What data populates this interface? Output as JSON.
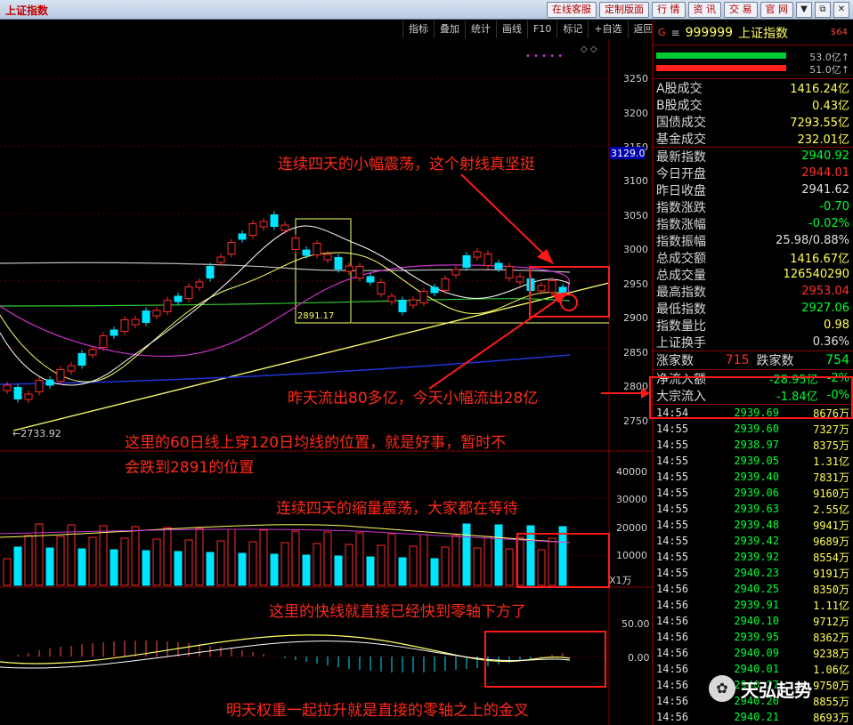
{
  "titlebar": {
    "title": "上证指数",
    "menu": [
      "在线客服",
      "定制版面",
      "行 情",
      "资 讯",
      "交 易",
      "官 网"
    ],
    "window_buttons": [
      "▼",
      "⧉",
      "✕"
    ]
  },
  "toolbar": [
    "指标",
    "叠加",
    "统计",
    "画线",
    "F10",
    "标记",
    "+自选",
    "返回"
  ],
  "chart": {
    "price_axis": [
      "3250",
      "3200",
      "3150",
      "3100",
      "3050",
      "3000",
      "2950",
      "2900",
      "2850",
      "2800",
      "2750"
    ],
    "price_highlight": "3129.0",
    "low_label": "←2733.92",
    "box_label": "2891.17",
    "volume_axis": [
      "40000",
      "30000",
      "20000",
      "10000"
    ],
    "volume_unit": "X1万",
    "macd_axis": [
      "50.00",
      "0.00"
    ]
  },
  "annotations": {
    "note1": "连续四天的小幅震荡，这个射线真坚挺",
    "note2": "昨天流出80多亿，今天小幅流出28亿",
    "note3a": "这里的60日线上穿120日均线的位置，就是好事，暂时不",
    "note3b": "会跌到2891的位置",
    "note4": "连续四天的缩量震荡，大家都在等待",
    "note5": "这里的快线就直接已经快到零轴下方了",
    "note6": "明天权重一起拉升就是直接的零轴之上的金叉"
  },
  "panel": {
    "letter": "G",
    "eq": "≡",
    "code": "999999",
    "name": "上证指数",
    "tag": "$64",
    "bar1_value": "53.0亿↑",
    "bar2_value": "51.0亿↑",
    "rows_a": [
      {
        "label": "A股成交",
        "value": "1416.24亿",
        "color": "#ffff55"
      },
      {
        "label": "B股成交",
        "value": "0.43亿",
        "color": "#ffff55"
      },
      {
        "label": "国债成交",
        "value": "7293.55亿",
        "color": "#ffff55"
      },
      {
        "label": "基金成交",
        "value": "232.01亿",
        "color": "#ffff55"
      }
    ],
    "rows_b": [
      {
        "label": "最新指数",
        "value": "2940.92",
        "color": "#00ff33"
      },
      {
        "label": "今日开盘",
        "value": "2944.01",
        "color": "#ff3030"
      },
      {
        "label": "昨日收盘",
        "value": "2941.62",
        "color": "#e0e0e0"
      },
      {
        "label": "指数涨跌",
        "value": "-0.70",
        "color": "#00ff33"
      },
      {
        "label": "指数涨幅",
        "value": "-0.02%",
        "color": "#00ff33"
      },
      {
        "label": "指数振幅",
        "value": "25.98/0.88%",
        "color": "#e0e0e0"
      },
      {
        "label": "总成交额",
        "value": "1416.67亿",
        "color": "#ffff55"
      },
      {
        "label": "总成交量",
        "value": "126540290",
        "color": "#ffff55"
      },
      {
        "label": "最高指数",
        "value": "2953.04",
        "color": "#ff3030"
      },
      {
        "label": "最低指数",
        "value": "2927.06",
        "color": "#00ff33"
      },
      {
        "label": "指数量比",
        "value": "0.98",
        "color": "#ffff55"
      },
      {
        "label": "上证换手",
        "value": "0.36%",
        "color": "#e0e0e0"
      }
    ],
    "up_label": "涨家数",
    "up_value": "715",
    "down_label": "跌家数",
    "down_value": "754",
    "flow": [
      {
        "label": "净流入额",
        "value": "-28.95亿",
        "pct": "-2%"
      },
      {
        "label": "大宗流入",
        "value": "-1.84亿",
        "pct": "-0%"
      }
    ],
    "ticks": [
      {
        "t": "14:54",
        "p": "2939.69",
        "v": "8676万"
      },
      {
        "t": "14:55",
        "p": "2939.60",
        "v": "7327万"
      },
      {
        "t": "14:55",
        "p": "2938.97",
        "v": "8375万"
      },
      {
        "t": "14:55",
        "p": "2939.05",
        "v": "1.31亿"
      },
      {
        "t": "14:55",
        "p": "2939.40",
        "v": "7831万"
      },
      {
        "t": "14:55",
        "p": "2939.06",
        "v": "9160万"
      },
      {
        "t": "14:55",
        "p": "2939.63",
        "v": "2.55亿"
      },
      {
        "t": "14:55",
        "p": "2939.48",
        "v": "9941万"
      },
      {
        "t": "14:55",
        "p": "2939.42",
        "v": "9689万"
      },
      {
        "t": "14:55",
        "p": "2939.92",
        "v": "8554万"
      },
      {
        "t": "14:55",
        "p": "2940.23",
        "v": "9191万"
      },
      {
        "t": "14:56",
        "p": "2940.25",
        "v": "8350万"
      },
      {
        "t": "14:56",
        "p": "2939.91",
        "v": "1.11亿"
      },
      {
        "t": "14:56",
        "p": "2940.10",
        "v": "9712万"
      },
      {
        "t": "14:56",
        "p": "2939.95",
        "v": "8362万"
      },
      {
        "t": "14:56",
        "p": "2940.09",
        "v": "9238万"
      },
      {
        "t": "14:56",
        "p": "2940.01",
        "v": "1.06亿"
      },
      {
        "t": "14:56",
        "p": "2940.27",
        "v": "9750万"
      },
      {
        "t": "14:56",
        "p": "2940.26",
        "v": "8855万"
      },
      {
        "t": "14:56",
        "p": "2940.21",
        "v": "8693万"
      }
    ]
  },
  "watermark": "天弘起势",
  "watermark_icon": "✿"
}
